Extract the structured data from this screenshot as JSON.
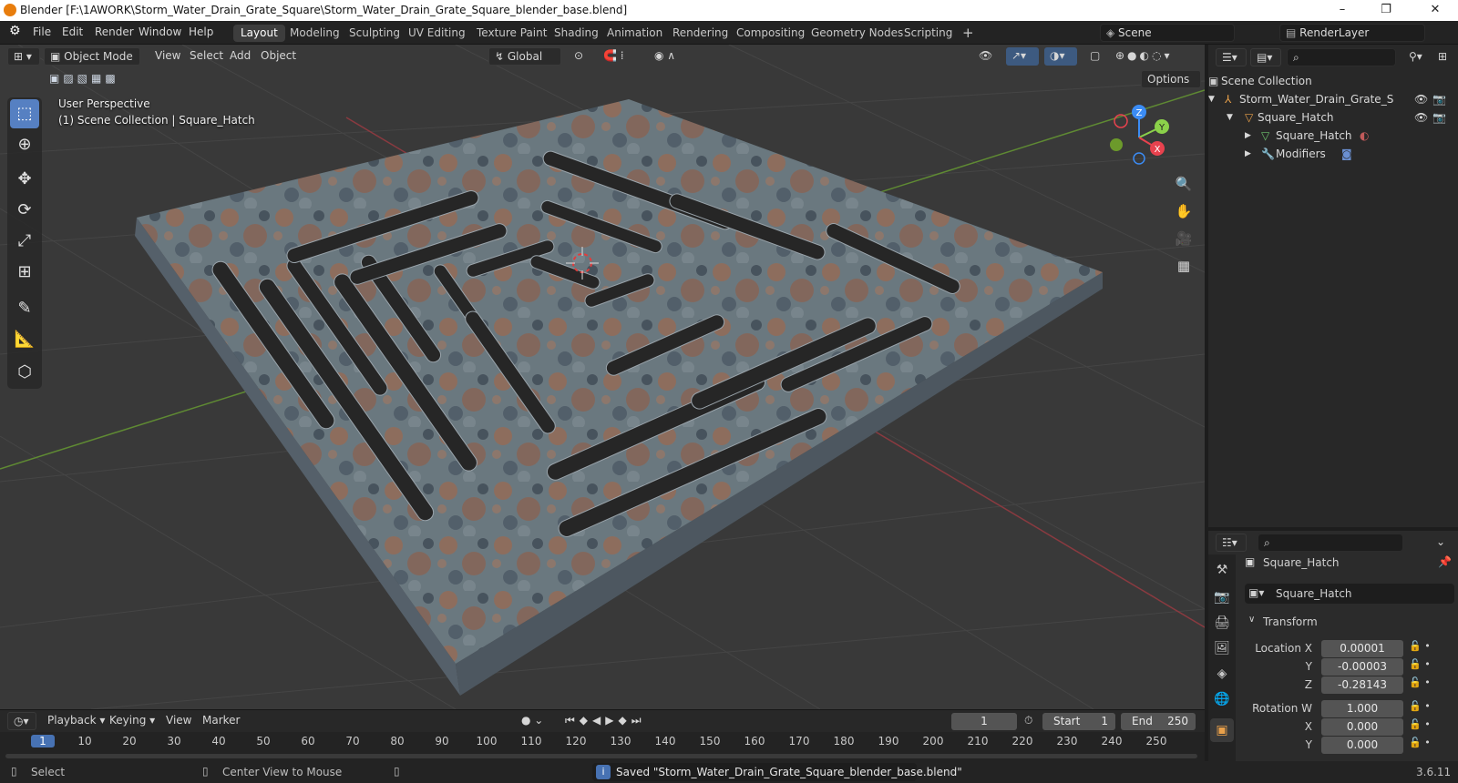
{
  "window": {
    "title": "Blender [F:\\1AWORK\\Storm_Water_Drain_Grate_Square\\Storm_Water_Drain_Grate_Square_blender_base.blend]",
    "controls": [
      "–",
      "❐",
      "✕"
    ]
  },
  "menubar": {
    "items": [
      "File",
      "Edit",
      "Render",
      "Window",
      "Help"
    ]
  },
  "workspaces": [
    "Layout",
    "Modeling",
    "Sculpting",
    "UV Editing",
    "Texture Paint",
    "Shading",
    "Animation",
    "Rendering",
    "Compositing",
    "Geometry Nodes",
    "Scripting"
  ],
  "active_workspace": "Layout",
  "scene": {
    "label": "Scene",
    "render_layer": "RenderLayer"
  },
  "viewport_header": {
    "mode": "Object Mode",
    "menus": [
      "View",
      "Select",
      "Add",
      "Object"
    ],
    "orientation": "Global",
    "options_label": "Options"
  },
  "viewport_overlay": {
    "perspective": "User Perspective",
    "collection_info": "(1) Scene Collection | Square_Hatch"
  },
  "gizmo": {
    "x": "X",
    "y": "Y",
    "z": "Z"
  },
  "outliner": {
    "root": "Scene Collection",
    "items": [
      {
        "label": "Storm_Water_Drain_Grate_S",
        "level": 1
      },
      {
        "label": "Square_Hatch",
        "level": 2
      },
      {
        "label": "Square_Hatch",
        "level": 3
      },
      {
        "label": "Modifiers",
        "level": 3
      }
    ]
  },
  "properties": {
    "object_name": "Square_Hatch",
    "data_name": "Square_Hatch",
    "section": "Transform",
    "fields": [
      {
        "label": "Location X",
        "value": "0.00001"
      },
      {
        "label": "Y",
        "value": "-0.00003"
      },
      {
        "label": "Z",
        "value": "-0.28143"
      },
      {
        "label": "Rotation W",
        "value": "1.000"
      },
      {
        "label": "X",
        "value": "0.000"
      },
      {
        "label": "Y",
        "value": "0.000"
      }
    ]
  },
  "timeline": {
    "menus": [
      "Playback",
      "Keying",
      "View",
      "Marker"
    ],
    "current_frame": "1",
    "start_label": "Start",
    "start": "1",
    "end_label": "End",
    "end": "250",
    "ruler": [
      "1",
      "10",
      "20",
      "30",
      "40",
      "50",
      "60",
      "70",
      "80",
      "90",
      "100",
      "110",
      "120",
      "130",
      "140",
      "150",
      "160",
      "170",
      "180",
      "190",
      "200",
      "210",
      "220",
      "230",
      "240",
      "250"
    ]
  },
  "statusbar": {
    "left": "Select",
    "middle": "Center View to Mouse",
    "message": "Saved \"Storm_Water_Drain_Grate_Square_blender_base.blend\"",
    "version": "3.6.11"
  },
  "colors": {
    "accent": "#5680c2",
    "x_axis": "#e8424e",
    "y_axis": "#8bd14a",
    "z_axis": "#3b8cf5"
  }
}
